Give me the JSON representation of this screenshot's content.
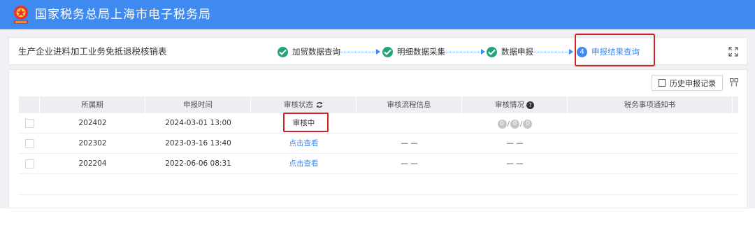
{
  "header": {
    "title": "国家税务总局上海市电子税务局"
  },
  "card": {
    "title": "生产企业进料加工业务免抵退税核销表"
  },
  "steps": [
    {
      "label": "加贸数据查询",
      "state": "done"
    },
    {
      "label": "明细数据采集",
      "state": "done"
    },
    {
      "label": "数据申报",
      "state": "done"
    },
    {
      "label": "申报结果查询",
      "state": "active",
      "number": "4"
    }
  ],
  "toolbar": {
    "history_label": "历史申报记录"
  },
  "table": {
    "columns": [
      "所属期",
      "申报时间",
      "审核状态",
      "审核流程信息",
      "审核情况",
      "税务事项通知书"
    ],
    "rows": [
      {
        "period": "202402",
        "time": "2024-03-01 13:00",
        "status": "审核中",
        "flow": "",
        "situation": "circles",
        "notice": ""
      },
      {
        "period": "202302",
        "time": "2023-03-16 13:40",
        "status": "点击查看",
        "flow": "— —",
        "situation": "— —",
        "notice": ""
      },
      {
        "period": "202204",
        "time": "2022-06-06 08:31",
        "status": "点击查看",
        "flow": "— —",
        "situation": "— —",
        "notice": ""
      }
    ],
    "circle_values": [
      "0",
      "0",
      "0"
    ]
  },
  "colors": {
    "brand": "#3f8af0",
    "success": "#21a47c",
    "highlight": "#d32222"
  }
}
